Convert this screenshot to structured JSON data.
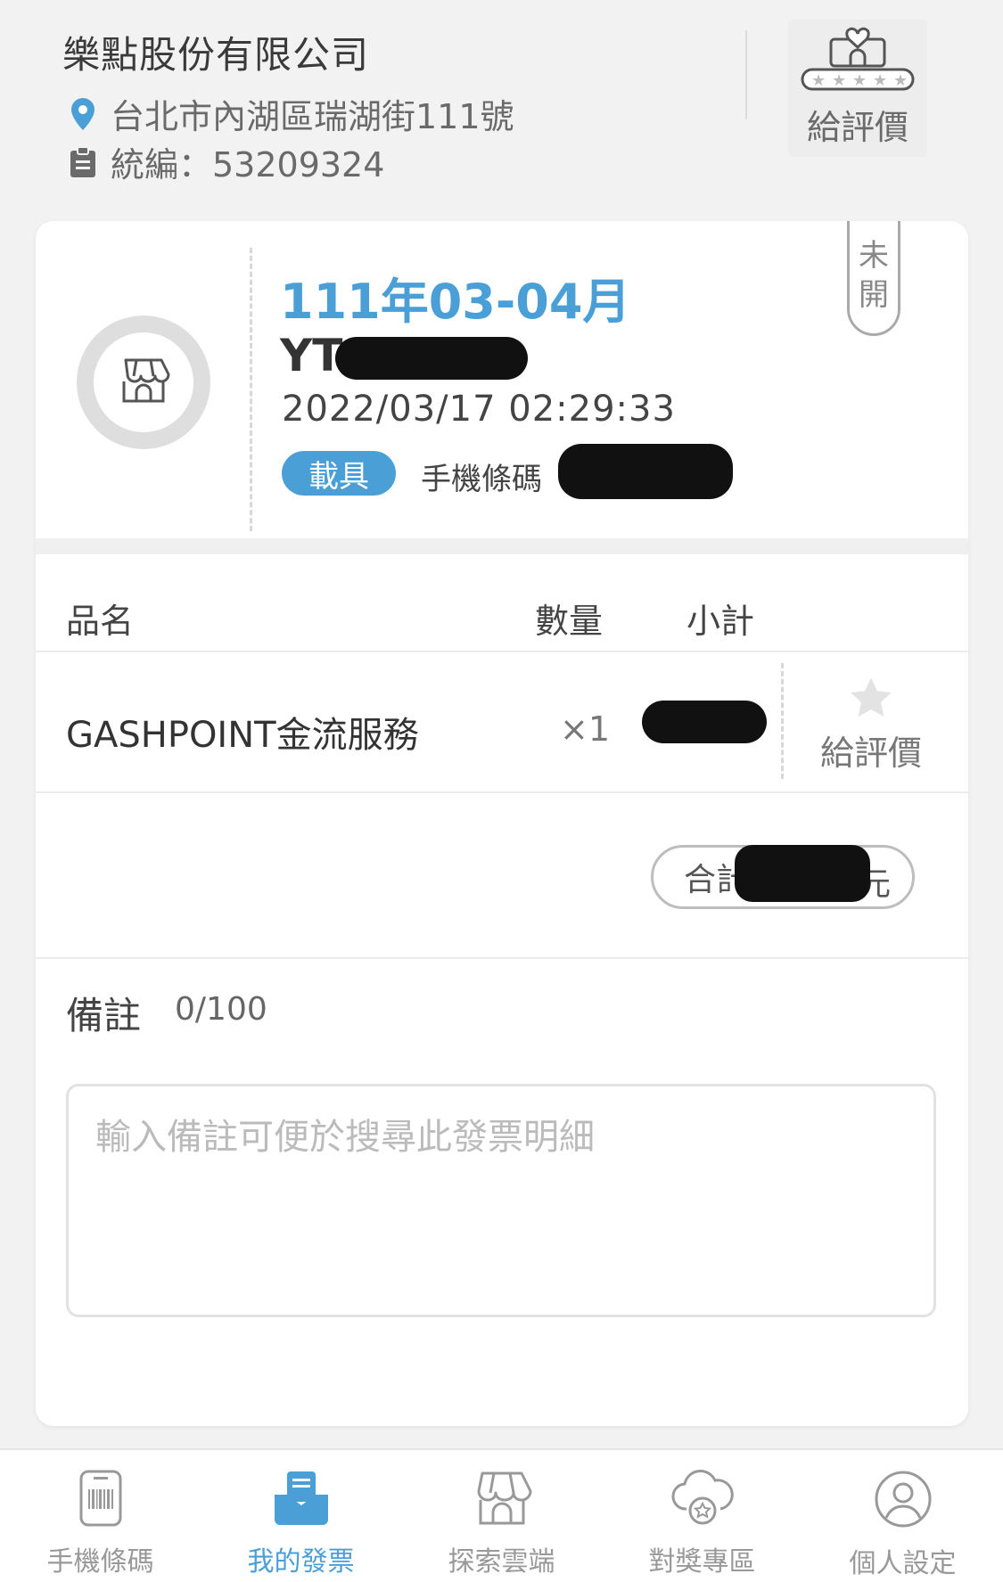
{
  "company": {
    "name": "樂點股份有限公司",
    "address": "台北市內湖區瑞湖街111號",
    "tax_id": "統編：53209324",
    "rate_label": "給評價"
  },
  "invoice": {
    "period": "111年03-04月",
    "number_prefix": "YT",
    "datetime": "2022/03/17 02:29:33",
    "carrier_badge": "載具",
    "carrier_type": "手機條碼",
    "status_tag": [
      "未",
      "開"
    ]
  },
  "items_table": {
    "headers": [
      "品名",
      "數量",
      "小計"
    ],
    "rows": [
      {
        "name": "GASHPOINT金流服務",
        "qty": "×1",
        "rate_label": "給評價"
      }
    ],
    "total_label": "合計",
    "total_unit": "元"
  },
  "notes": {
    "label": "備註",
    "count": "0/100",
    "placeholder": "輸入備註可便於搜尋此發票明細"
  },
  "bottom_nav": [
    {
      "label": "手機條碼",
      "icon": "barcode-phone-icon",
      "active": false
    },
    {
      "label": "我的發票",
      "icon": "invoice-inbox-icon",
      "active": true
    },
    {
      "label": "探索雲端",
      "icon": "store-icon",
      "active": false
    },
    {
      "label": "對獎專區",
      "icon": "cloud-star-icon",
      "active": false
    },
    {
      "label": "個人設定",
      "icon": "user-icon",
      "active": false
    }
  ],
  "colors": {
    "accent": "#4a9fd6",
    "background": "#f2f2f2",
    "redaction": "#111111"
  }
}
